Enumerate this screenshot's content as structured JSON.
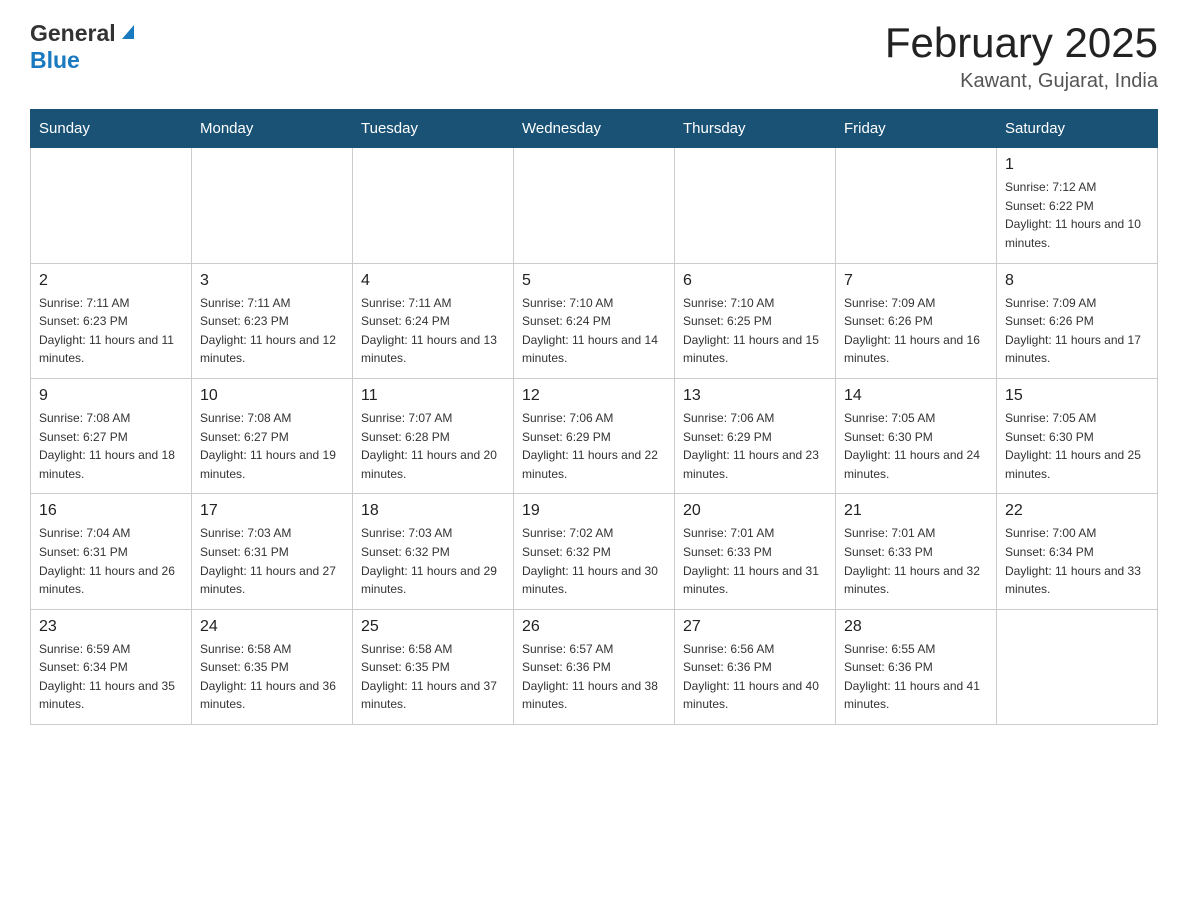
{
  "logo": {
    "general": "General",
    "blue": "Blue"
  },
  "header": {
    "title": "February 2025",
    "subtitle": "Kawant, Gujarat, India"
  },
  "weekdays": [
    "Sunday",
    "Monday",
    "Tuesday",
    "Wednesday",
    "Thursday",
    "Friday",
    "Saturday"
  ],
  "weeks": [
    [
      {
        "day": "",
        "info": ""
      },
      {
        "day": "",
        "info": ""
      },
      {
        "day": "",
        "info": ""
      },
      {
        "day": "",
        "info": ""
      },
      {
        "day": "",
        "info": ""
      },
      {
        "day": "",
        "info": ""
      },
      {
        "day": "1",
        "info": "Sunrise: 7:12 AM\nSunset: 6:22 PM\nDaylight: 11 hours and 10 minutes."
      }
    ],
    [
      {
        "day": "2",
        "info": "Sunrise: 7:11 AM\nSunset: 6:23 PM\nDaylight: 11 hours and 11 minutes."
      },
      {
        "day": "3",
        "info": "Sunrise: 7:11 AM\nSunset: 6:23 PM\nDaylight: 11 hours and 12 minutes."
      },
      {
        "day": "4",
        "info": "Sunrise: 7:11 AM\nSunset: 6:24 PM\nDaylight: 11 hours and 13 minutes."
      },
      {
        "day": "5",
        "info": "Sunrise: 7:10 AM\nSunset: 6:24 PM\nDaylight: 11 hours and 14 minutes."
      },
      {
        "day": "6",
        "info": "Sunrise: 7:10 AM\nSunset: 6:25 PM\nDaylight: 11 hours and 15 minutes."
      },
      {
        "day": "7",
        "info": "Sunrise: 7:09 AM\nSunset: 6:26 PM\nDaylight: 11 hours and 16 minutes."
      },
      {
        "day": "8",
        "info": "Sunrise: 7:09 AM\nSunset: 6:26 PM\nDaylight: 11 hours and 17 minutes."
      }
    ],
    [
      {
        "day": "9",
        "info": "Sunrise: 7:08 AM\nSunset: 6:27 PM\nDaylight: 11 hours and 18 minutes."
      },
      {
        "day": "10",
        "info": "Sunrise: 7:08 AM\nSunset: 6:27 PM\nDaylight: 11 hours and 19 minutes."
      },
      {
        "day": "11",
        "info": "Sunrise: 7:07 AM\nSunset: 6:28 PM\nDaylight: 11 hours and 20 minutes."
      },
      {
        "day": "12",
        "info": "Sunrise: 7:06 AM\nSunset: 6:29 PM\nDaylight: 11 hours and 22 minutes."
      },
      {
        "day": "13",
        "info": "Sunrise: 7:06 AM\nSunset: 6:29 PM\nDaylight: 11 hours and 23 minutes."
      },
      {
        "day": "14",
        "info": "Sunrise: 7:05 AM\nSunset: 6:30 PM\nDaylight: 11 hours and 24 minutes."
      },
      {
        "day": "15",
        "info": "Sunrise: 7:05 AM\nSunset: 6:30 PM\nDaylight: 11 hours and 25 minutes."
      }
    ],
    [
      {
        "day": "16",
        "info": "Sunrise: 7:04 AM\nSunset: 6:31 PM\nDaylight: 11 hours and 26 minutes."
      },
      {
        "day": "17",
        "info": "Sunrise: 7:03 AM\nSunset: 6:31 PM\nDaylight: 11 hours and 27 minutes."
      },
      {
        "day": "18",
        "info": "Sunrise: 7:03 AM\nSunset: 6:32 PM\nDaylight: 11 hours and 29 minutes."
      },
      {
        "day": "19",
        "info": "Sunrise: 7:02 AM\nSunset: 6:32 PM\nDaylight: 11 hours and 30 minutes."
      },
      {
        "day": "20",
        "info": "Sunrise: 7:01 AM\nSunset: 6:33 PM\nDaylight: 11 hours and 31 minutes."
      },
      {
        "day": "21",
        "info": "Sunrise: 7:01 AM\nSunset: 6:33 PM\nDaylight: 11 hours and 32 minutes."
      },
      {
        "day": "22",
        "info": "Sunrise: 7:00 AM\nSunset: 6:34 PM\nDaylight: 11 hours and 33 minutes."
      }
    ],
    [
      {
        "day": "23",
        "info": "Sunrise: 6:59 AM\nSunset: 6:34 PM\nDaylight: 11 hours and 35 minutes."
      },
      {
        "day": "24",
        "info": "Sunrise: 6:58 AM\nSunset: 6:35 PM\nDaylight: 11 hours and 36 minutes."
      },
      {
        "day": "25",
        "info": "Sunrise: 6:58 AM\nSunset: 6:35 PM\nDaylight: 11 hours and 37 minutes."
      },
      {
        "day": "26",
        "info": "Sunrise: 6:57 AM\nSunset: 6:36 PM\nDaylight: 11 hours and 38 minutes."
      },
      {
        "day": "27",
        "info": "Sunrise: 6:56 AM\nSunset: 6:36 PM\nDaylight: 11 hours and 40 minutes."
      },
      {
        "day": "28",
        "info": "Sunrise: 6:55 AM\nSunset: 6:36 PM\nDaylight: 11 hours and 41 minutes."
      },
      {
        "day": "",
        "info": ""
      }
    ]
  ]
}
